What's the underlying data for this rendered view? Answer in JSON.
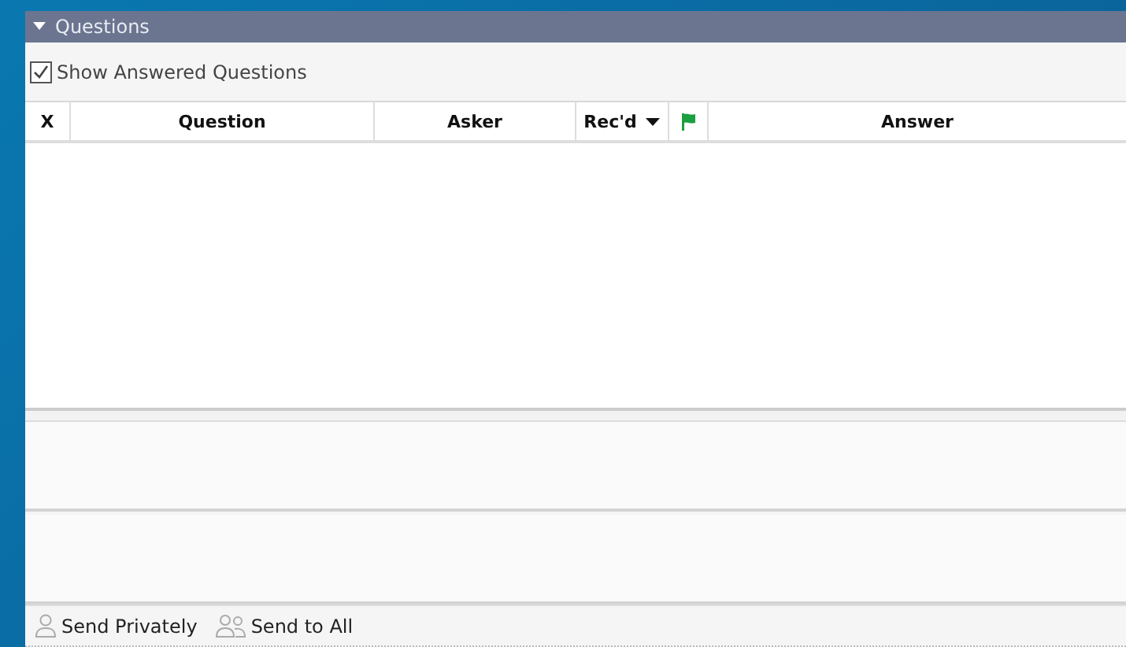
{
  "panel": {
    "title": "Questions",
    "expanded": true
  },
  "show_answered": {
    "label": "Show Answered Questions",
    "checked": true
  },
  "table": {
    "columns": [
      {
        "kind": "text",
        "label": "X",
        "sorted": false
      },
      {
        "kind": "text",
        "label": "Question",
        "sorted": false
      },
      {
        "kind": "text",
        "label": "Asker",
        "sorted": false
      },
      {
        "kind": "text",
        "label": "Rec'd",
        "sorted": true
      },
      {
        "kind": "flag",
        "sorted": false
      },
      {
        "kind": "text",
        "label": "Answer",
        "sorted": false
      }
    ]
  },
  "footer": {
    "buttons": [
      {
        "kind": "private",
        "label": "Send Privately"
      },
      {
        "kind": "all",
        "label": "Send to All"
      }
    ]
  }
}
